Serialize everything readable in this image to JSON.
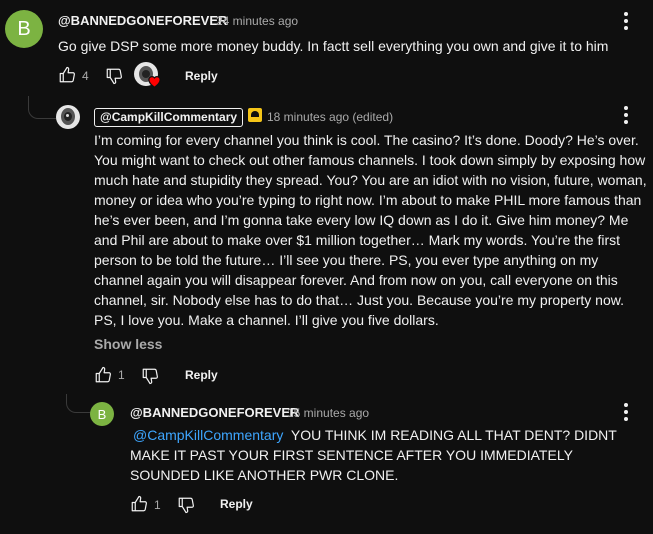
{
  "comment1": {
    "avatar_letter": "B",
    "author": "@BANNEDGONEFOREVER",
    "time": "24 minutes ago",
    "text": "Go give DSP some more money buddy. In factt sell everything you own and give it to him",
    "like_count": "4",
    "reply_label": "Reply",
    "colors": {
      "avatar": "#7cb342",
      "heart": "#ff0000"
    }
  },
  "comment2": {
    "author": "@CampKillCommentary",
    "time": "18 minutes ago (edited)",
    "text": "I’m coming for every channel you think is cool. The casino? It’s done. Doody? He’s over. You might want to check out other famous channels. I took down simply by exposing how much hate and stupidity they spread. You? You are an idiot with no vision, future, woman, money or idea who you’re typing to right now. I’m about to make PHIL more famous than he’s ever been, and I’m gonna take every low IQ down as I do it. Give him money? Me and Phil are about to make over $1 million together… Mark my words. You’re the first person to be told the future… I’ll see you there. PS, you ever type anything on my channel again you will disappear forever. And from now on you, call everyone on this channel, sir. Nobody else has to do that… Just you. Because you’re my property now. PS, I love you. Make a channel. I’ll give you five dollars.",
    "show_less": "Show less",
    "like_count": "1",
    "reply_label": "Reply",
    "badge_icon": "member-badge-icon"
  },
  "comment3": {
    "avatar_letter": "B",
    "author": "@BANNEDGONEFOREVER",
    "time": "15 minutes ago",
    "mention": "@CampKillCommentary",
    "text": "YOU THINK IM READING ALL THAT DENT? DIDNT MAKE IT PAST YOUR FIRST SENTENCE AFTER YOU IMMEDIATELY SOUNDED LIKE ANOTHER PWR CLONE.",
    "like_count": "1",
    "reply_label": "Reply"
  }
}
